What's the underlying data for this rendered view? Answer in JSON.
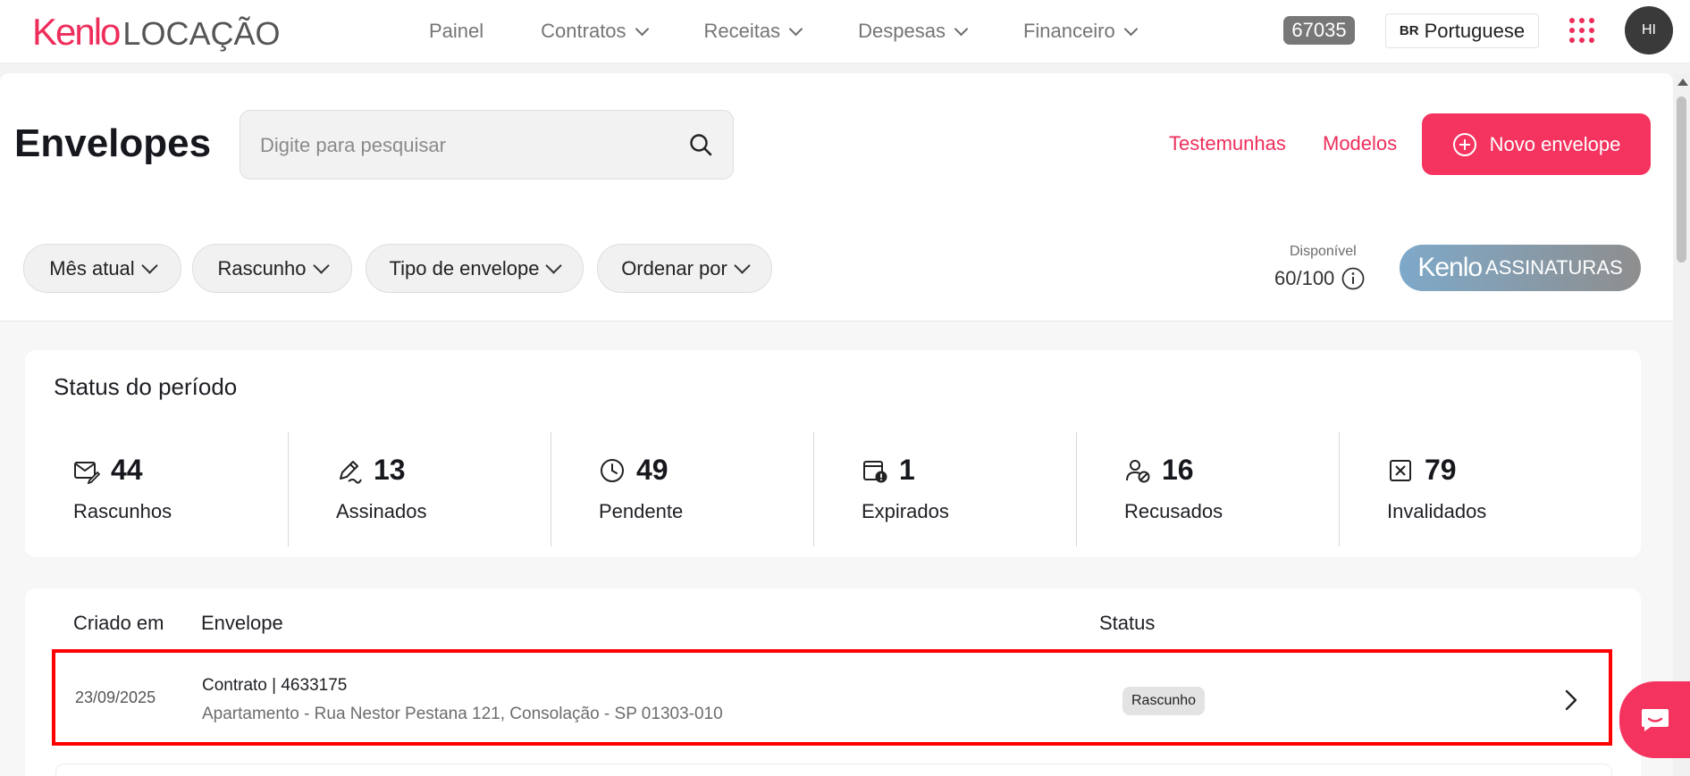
{
  "header": {
    "logo_brand": "Kenlo",
    "logo_product": "LOCAÇÃO",
    "nav": [
      {
        "label": "Painel",
        "dropdown": false
      },
      {
        "label": "Contratos",
        "dropdown": true
      },
      {
        "label": "Receitas",
        "dropdown": true
      },
      {
        "label": "Despesas",
        "dropdown": true
      },
      {
        "label": "Financeiro",
        "dropdown": true
      }
    ],
    "badge": "67035",
    "language_code": "BR",
    "language": "Portuguese",
    "avatar_initials": "HI"
  },
  "page": {
    "title": "Envelopes",
    "search_placeholder": "Digite para pesquisar",
    "witnesses_link": "Testemunhas",
    "templates_link": "Modelos",
    "new_button": "Novo envelope"
  },
  "filters": [
    {
      "label": "Mês atual"
    },
    {
      "label": "Rascunho"
    },
    {
      "label": "Tipo de envelope"
    },
    {
      "label": "Ordenar por"
    }
  ],
  "availability": {
    "label": "Disponível",
    "count": "60/100"
  },
  "signatures_badge": {
    "brand": "Kenlo",
    "product": "ASSINATURAS"
  },
  "status_period": {
    "title": "Status do período",
    "items": [
      {
        "icon": "envelope-edit-icon",
        "count": "44",
        "label": "Rascunhos"
      },
      {
        "icon": "signature-pen-icon",
        "count": "13",
        "label": "Assinados"
      },
      {
        "icon": "clock-icon",
        "count": "49",
        "label": "Pendente"
      },
      {
        "icon": "calendar-alert-icon",
        "count": "1",
        "label": "Expirados"
      },
      {
        "icon": "user-blocked-icon",
        "count": "16",
        "label": "Recusados"
      },
      {
        "icon": "close-box-icon",
        "count": "79",
        "label": "Invalidados"
      }
    ]
  },
  "table": {
    "headers": {
      "created": "Criado em",
      "envelope": "Envelope",
      "status": "Status"
    },
    "rows": [
      {
        "date": "23/09/2025",
        "title": "Contrato | 4633175",
        "subtitle": "Apartamento - Rua Nestor Pestana 121, Consolação - SP 01303-010",
        "status": "Rascunho"
      }
    ]
  },
  "colors": {
    "accent": "#f4335f",
    "brand": "#ee2d5b",
    "highlight_outline": "#ff0000"
  }
}
